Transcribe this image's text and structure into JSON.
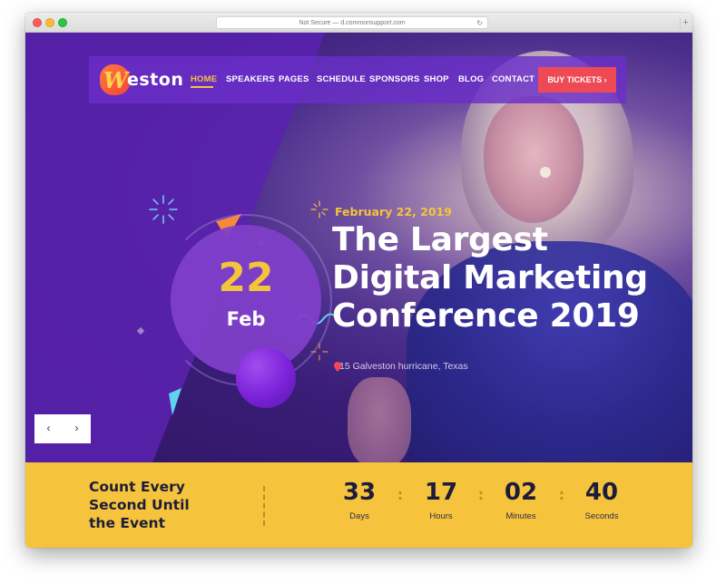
{
  "browser": {
    "url_text": "Not Secure — d.commonsupport.com",
    "reload_icon": "reload-icon",
    "new_tab_icon": "plus-icon"
  },
  "header": {
    "logo_mark": "W",
    "logo_text": "eston",
    "nav": [
      {
        "label": "HOME",
        "active": true
      },
      {
        "label": "SPEAKERS"
      },
      {
        "label": "PAGES"
      },
      {
        "label": "SCHEDULE"
      },
      {
        "label": "SPONSORS"
      },
      {
        "label": "SHOP"
      },
      {
        "label": "BLOG"
      },
      {
        "label": "CONTACT"
      }
    ],
    "cta_label": "BUY TICKETS",
    "cta_icon": "chevron-right-icon"
  },
  "hero": {
    "day": "22",
    "month": "Feb",
    "event_date": "February 22, 2019",
    "headline": [
      "The Largest",
      "Digital Marketing",
      "Conference 2019"
    ],
    "location": "15 Galveston hurricane, Texas",
    "location_icon": "map-pin-icon",
    "slider_prev": "‹",
    "slider_next": "›"
  },
  "countdown": {
    "label": [
      "Count Every",
      "Second Until",
      "the Event"
    ],
    "units": [
      {
        "value": "33",
        "name": "Days"
      },
      {
        "value": "17",
        "name": "Hours"
      },
      {
        "value": "02",
        "name": "Minutes"
      },
      {
        "value": "40",
        "name": "Seconds"
      }
    ],
    "separator": ":"
  },
  "colors": {
    "primary_purple": "#6a2ec8",
    "accent_yellow": "#f4c43c",
    "cta_red": "#ee4a55",
    "dark_text": "#1d1d3a"
  }
}
